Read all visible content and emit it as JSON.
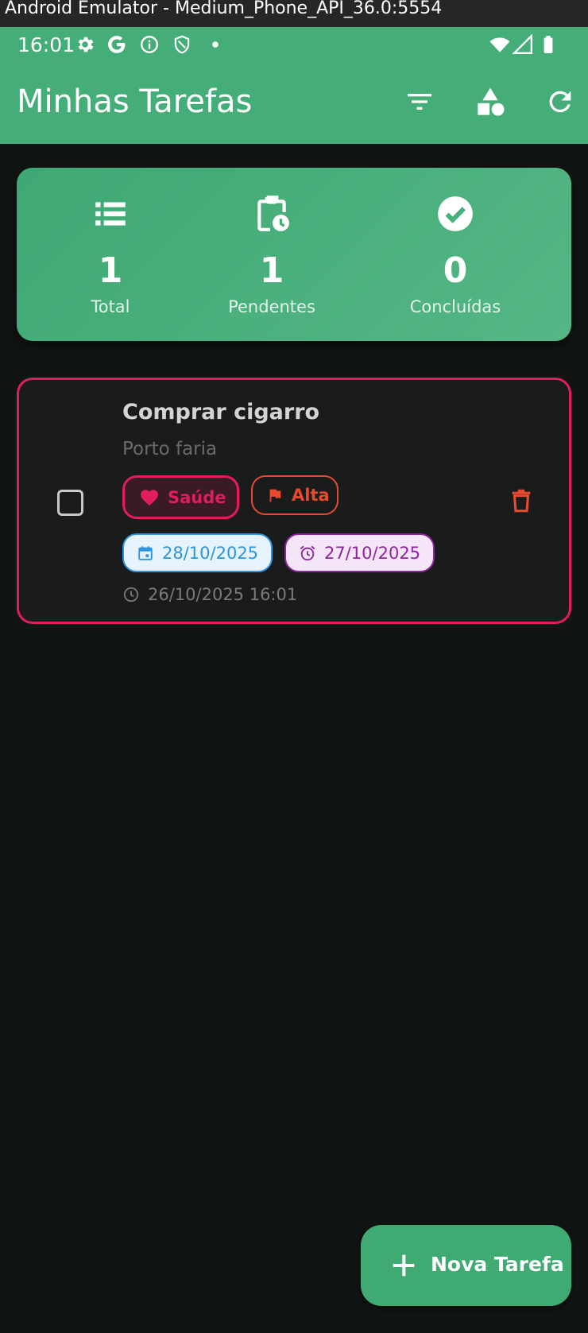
{
  "window": {
    "title": "Android Emulator - Medium_Phone_API_36.0:5554"
  },
  "status_bar": {
    "time": "16:01",
    "icons": [
      "settings-icon",
      "google-icon",
      "info-icon",
      "shield-icon",
      "dot-icon",
      "wifi-icon",
      "signal-icon",
      "battery-icon"
    ]
  },
  "app_bar": {
    "title": "Minhas Tarefas",
    "actions": [
      "filter-icon",
      "category-icon",
      "refresh-icon"
    ],
    "color": "#45ad78"
  },
  "stats": {
    "total": {
      "value": "1",
      "label": "Total",
      "icon": "list-icon"
    },
    "pending": {
      "value": "1",
      "label": "Pendentes",
      "icon": "clipboard-clock-icon"
    },
    "done": {
      "value": "0",
      "label": "Concluídas",
      "icon": "check-circle-icon"
    }
  },
  "tasks": [
    {
      "title": "Comprar cigarro",
      "description": "Porto faria",
      "checked": false,
      "category": {
        "label": "Saúde",
        "icon": "heart-icon",
        "color": "#e21d5c"
      },
      "priority": {
        "label": "Alta",
        "icon": "flag-icon",
        "color": "#e64a2f"
      },
      "due_date": {
        "label": "28/10/2025",
        "icon": "calendar-icon",
        "color": "#2c95e0"
      },
      "reminder": {
        "label": "27/10/2025",
        "icon": "alarm-icon",
        "color": "#8e249f"
      },
      "created": {
        "label": "26/10/2025 16:01",
        "icon": "clock-icon"
      }
    }
  ],
  "fab": {
    "label": "Nova Tarefa",
    "icon": "plus-icon"
  }
}
